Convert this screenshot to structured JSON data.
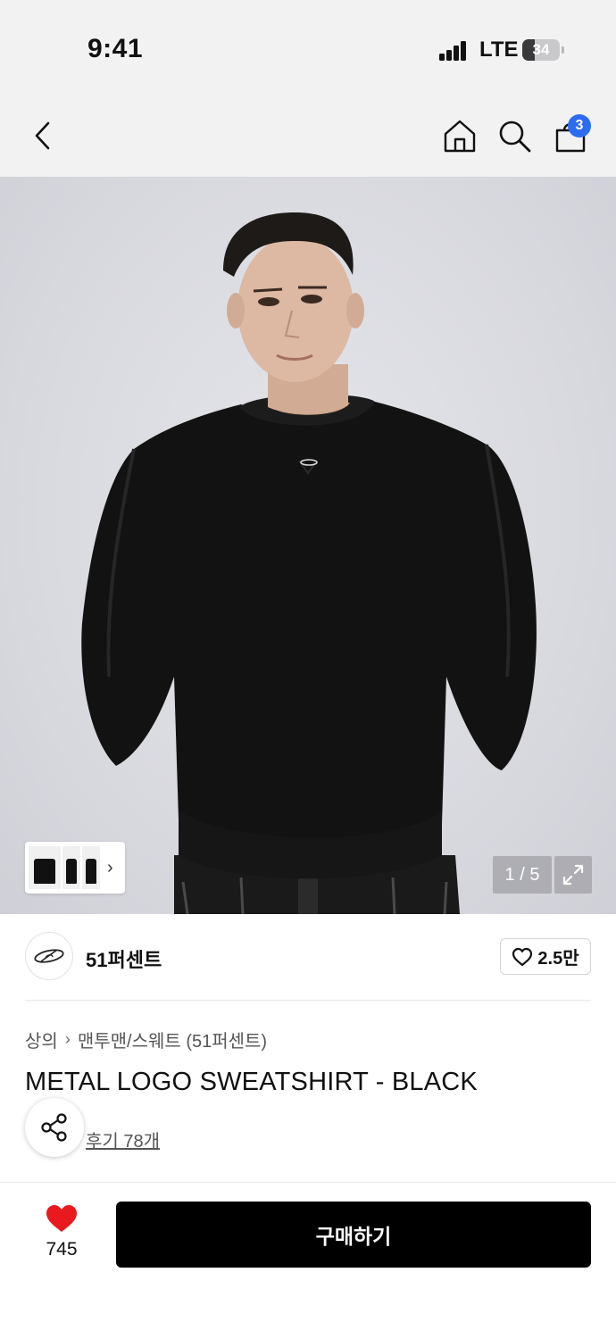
{
  "status_bar": {
    "time": "9:41",
    "network": "LTE",
    "battery": "34",
    "battery_level_percent": 34
  },
  "nav": {
    "back_icon": "chevron-left-icon",
    "home_icon": "home-icon",
    "search_icon": "search-icon",
    "cart_icon": "shopping-bag-icon",
    "cart_badge": "3",
    "badge_color": "#2b6cf0"
  },
  "gallery": {
    "counter": "1 / 5",
    "expand_icon": "expand-icon",
    "thumb_chevron": "›"
  },
  "brand": {
    "name": "51퍼센트",
    "likes": "2.5만",
    "like_icon": "heart-outline-icon"
  },
  "product": {
    "breadcrumb": [
      "상의",
      "맨투맨/스웨트 (51퍼센트)"
    ],
    "breadcrumb_separator": "›",
    "title": "METAL LOGO SWEATSHIRT - BLACK",
    "review_link": "후기 78개",
    "share_icon": "share-icon"
  },
  "bottom_bar": {
    "wish_icon": "heart-filled-icon",
    "wish_color": "#e8191f",
    "wish_count": "745",
    "buy_label": "구매하기"
  }
}
